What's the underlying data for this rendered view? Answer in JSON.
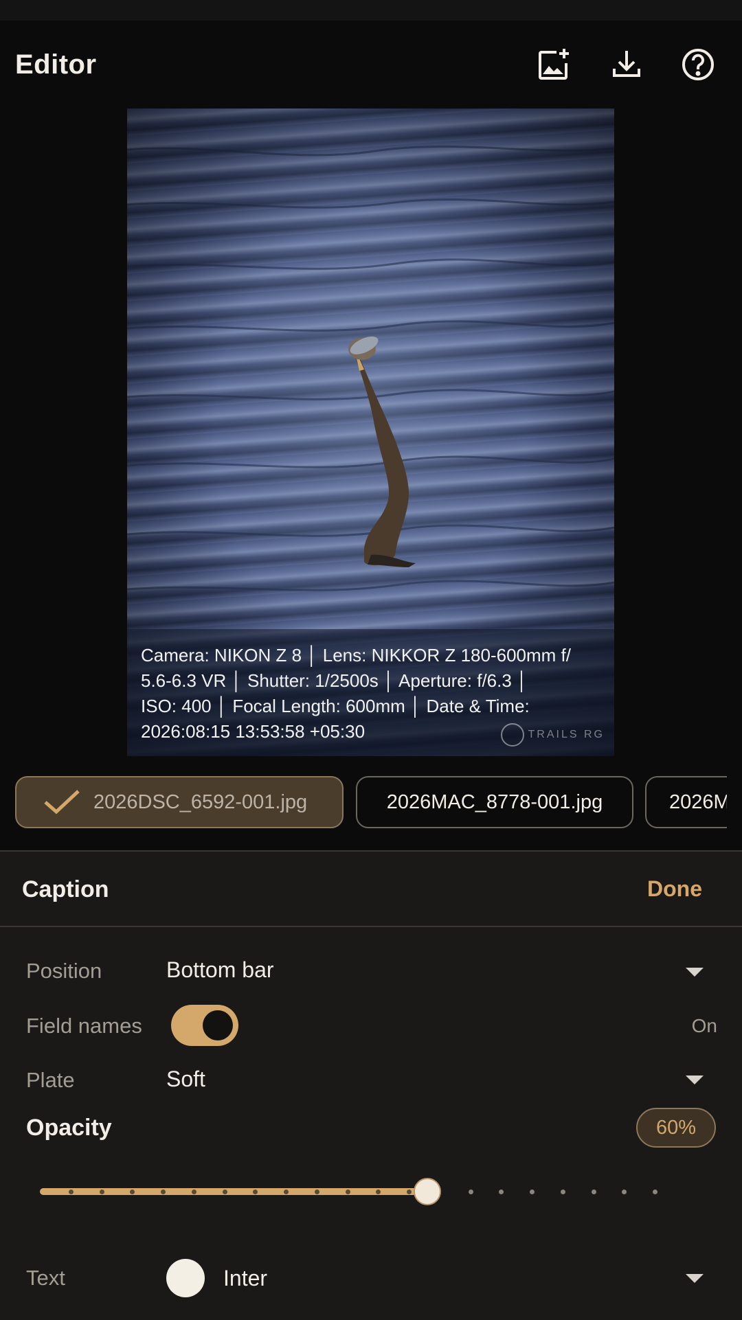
{
  "app": {
    "title": "Editor",
    "actions": [
      "add-image-icon",
      "download-icon",
      "help-icon"
    ]
  },
  "photo": {
    "caption_lines": [
      "Camera: NIKON Z 8 │ Lens: NIKKOR Z 180-600mm f/",
      "5.6-6.3 VR │ Shutter: 1/2500s │ Aperture: f/6.3 │",
      "ISO: 400 │ Focal Length: 600mm │ Date & Time:",
      "2026:08:15 13:53:58 +05:30"
    ],
    "watermark": "TRAILS RG"
  },
  "files": [
    {
      "name": "2026DSC_6592-001.jpg",
      "selected": true
    },
    {
      "name": "2026MAC_8778-001.jpg",
      "selected": false
    },
    {
      "name": "2026M",
      "selected": false
    }
  ],
  "sheet": {
    "title": "Caption",
    "done_label": "Done",
    "position": {
      "label": "Position",
      "value": "Bottom bar"
    },
    "field_names": {
      "label": "Field names",
      "state": "On"
    },
    "plate": {
      "label": "Plate",
      "value": "Soft"
    },
    "opacity": {
      "label": "Opacity",
      "value_label": "60%",
      "fraction": 0.6
    },
    "text": {
      "label": "Text",
      "font": "Inter",
      "color": "#f4efe4"
    }
  },
  "colors": {
    "accent": "#d4a86a",
    "background": "#0b0b0b",
    "sheet": "#1b1917"
  }
}
